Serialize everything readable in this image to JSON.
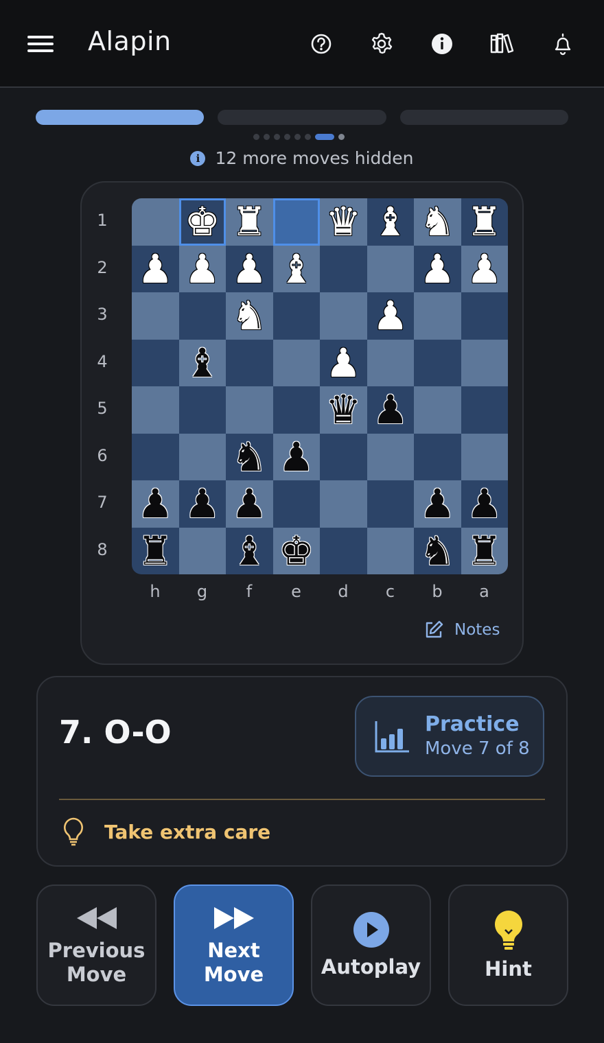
{
  "header": {
    "title": "Alapin",
    "icons": [
      "menu-icon",
      "help-icon",
      "gear-icon",
      "info-icon",
      "library-icon",
      "bell-icon"
    ]
  },
  "progress": {
    "segments": [
      1,
      0,
      0
    ],
    "dots_total": 8,
    "dots_current": 7,
    "hidden_text": "12 more moves hidden"
  },
  "board": {
    "ranks": [
      "1",
      "2",
      "3",
      "4",
      "5",
      "6",
      "7",
      "8"
    ],
    "files": [
      "h",
      "g",
      "f",
      "e",
      "d",
      "c",
      "b",
      "a"
    ],
    "highlight": [
      "g1",
      "e1"
    ],
    "rows": [
      [
        "",
        "wK",
        "wR",
        "",
        "wQ",
        "wB",
        "wN",
        "wR"
      ],
      [
        "wP",
        "wP",
        "wP",
        "wB",
        "",
        "",
        "wP",
        "wP"
      ],
      [
        "",
        "",
        "wN",
        "",
        "",
        "wP",
        "",
        ""
      ],
      [
        "",
        "bB",
        "",
        "",
        "wP",
        "",
        "",
        ""
      ],
      [
        "",
        "",
        "",
        "",
        "bQ",
        "bP",
        "",
        ""
      ],
      [
        "",
        "",
        "bN",
        "bP",
        "",
        "",
        "",
        ""
      ],
      [
        "bP",
        "bP",
        "bP",
        "",
        "",
        "",
        "bP",
        "bP"
      ],
      [
        "bR",
        "",
        "bB",
        "bK",
        "",
        "",
        "bN",
        "bR"
      ]
    ],
    "notes_label": "Notes"
  },
  "move": {
    "text": "7. O-O",
    "practice_title": "Practice",
    "practice_sub": "Move 7 of 8",
    "tip": "Take extra care"
  },
  "buttons": {
    "prev": "Previous\nMove",
    "next": "Next\nMove",
    "autoplay": "Autoplay",
    "hint": "Hint"
  },
  "colors": {
    "accent": "#7ca7e6",
    "light_square": "#5d7799",
    "dark_square": "#2c4468",
    "tip": "#f0c472",
    "hint_bulb": "#f5d63d"
  }
}
